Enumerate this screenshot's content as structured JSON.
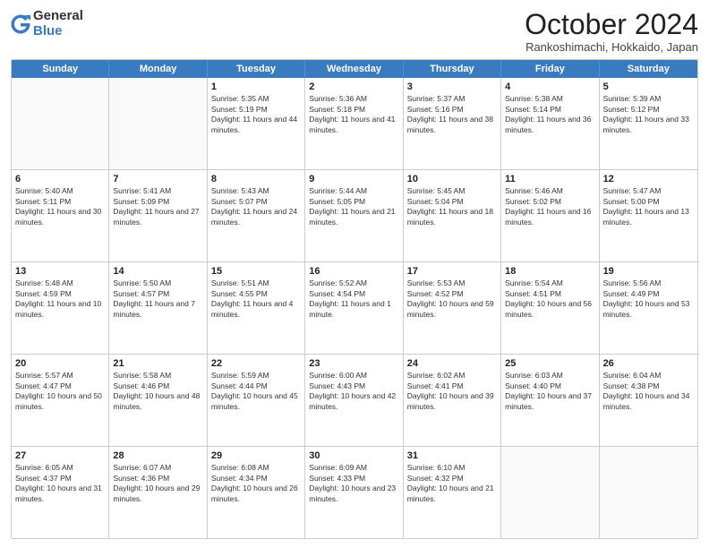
{
  "logo": {
    "general": "General",
    "blue": "Blue"
  },
  "title": "October 2024",
  "subtitle": "Rankoshimachi, Hokkaido, Japan",
  "headers": [
    "Sunday",
    "Monday",
    "Tuesday",
    "Wednesday",
    "Thursday",
    "Friday",
    "Saturday"
  ],
  "weeks": [
    [
      {
        "day": "",
        "sunrise": "",
        "sunset": "",
        "daylight": ""
      },
      {
        "day": "",
        "sunrise": "",
        "sunset": "",
        "daylight": ""
      },
      {
        "day": "1",
        "sunrise": "Sunrise: 5:35 AM",
        "sunset": "Sunset: 5:19 PM",
        "daylight": "Daylight: 11 hours and 44 minutes."
      },
      {
        "day": "2",
        "sunrise": "Sunrise: 5:36 AM",
        "sunset": "Sunset: 5:18 PM",
        "daylight": "Daylight: 11 hours and 41 minutes."
      },
      {
        "day": "3",
        "sunrise": "Sunrise: 5:37 AM",
        "sunset": "Sunset: 5:16 PM",
        "daylight": "Daylight: 11 hours and 38 minutes."
      },
      {
        "day": "4",
        "sunrise": "Sunrise: 5:38 AM",
        "sunset": "Sunset: 5:14 PM",
        "daylight": "Daylight: 11 hours and 36 minutes."
      },
      {
        "day": "5",
        "sunrise": "Sunrise: 5:39 AM",
        "sunset": "Sunset: 5:12 PM",
        "daylight": "Daylight: 11 hours and 33 minutes."
      }
    ],
    [
      {
        "day": "6",
        "sunrise": "Sunrise: 5:40 AM",
        "sunset": "Sunset: 5:11 PM",
        "daylight": "Daylight: 11 hours and 30 minutes."
      },
      {
        "day": "7",
        "sunrise": "Sunrise: 5:41 AM",
        "sunset": "Sunset: 5:09 PM",
        "daylight": "Daylight: 11 hours and 27 minutes."
      },
      {
        "day": "8",
        "sunrise": "Sunrise: 5:43 AM",
        "sunset": "Sunset: 5:07 PM",
        "daylight": "Daylight: 11 hours and 24 minutes."
      },
      {
        "day": "9",
        "sunrise": "Sunrise: 5:44 AM",
        "sunset": "Sunset: 5:05 PM",
        "daylight": "Daylight: 11 hours and 21 minutes."
      },
      {
        "day": "10",
        "sunrise": "Sunrise: 5:45 AM",
        "sunset": "Sunset: 5:04 PM",
        "daylight": "Daylight: 11 hours and 18 minutes."
      },
      {
        "day": "11",
        "sunrise": "Sunrise: 5:46 AM",
        "sunset": "Sunset: 5:02 PM",
        "daylight": "Daylight: 11 hours and 16 minutes."
      },
      {
        "day": "12",
        "sunrise": "Sunrise: 5:47 AM",
        "sunset": "Sunset: 5:00 PM",
        "daylight": "Daylight: 11 hours and 13 minutes."
      }
    ],
    [
      {
        "day": "13",
        "sunrise": "Sunrise: 5:48 AM",
        "sunset": "Sunset: 4:59 PM",
        "daylight": "Daylight: 11 hours and 10 minutes."
      },
      {
        "day": "14",
        "sunrise": "Sunrise: 5:50 AM",
        "sunset": "Sunset: 4:57 PM",
        "daylight": "Daylight: 11 hours and 7 minutes."
      },
      {
        "day": "15",
        "sunrise": "Sunrise: 5:51 AM",
        "sunset": "Sunset: 4:55 PM",
        "daylight": "Daylight: 11 hours and 4 minutes."
      },
      {
        "day": "16",
        "sunrise": "Sunrise: 5:52 AM",
        "sunset": "Sunset: 4:54 PM",
        "daylight": "Daylight: 11 hours and 1 minute."
      },
      {
        "day": "17",
        "sunrise": "Sunrise: 5:53 AM",
        "sunset": "Sunset: 4:52 PM",
        "daylight": "Daylight: 10 hours and 59 minutes."
      },
      {
        "day": "18",
        "sunrise": "Sunrise: 5:54 AM",
        "sunset": "Sunset: 4:51 PM",
        "daylight": "Daylight: 10 hours and 56 minutes."
      },
      {
        "day": "19",
        "sunrise": "Sunrise: 5:56 AM",
        "sunset": "Sunset: 4:49 PM",
        "daylight": "Daylight: 10 hours and 53 minutes."
      }
    ],
    [
      {
        "day": "20",
        "sunrise": "Sunrise: 5:57 AM",
        "sunset": "Sunset: 4:47 PM",
        "daylight": "Daylight: 10 hours and 50 minutes."
      },
      {
        "day": "21",
        "sunrise": "Sunrise: 5:58 AM",
        "sunset": "Sunset: 4:46 PM",
        "daylight": "Daylight: 10 hours and 48 minutes."
      },
      {
        "day": "22",
        "sunrise": "Sunrise: 5:59 AM",
        "sunset": "Sunset: 4:44 PM",
        "daylight": "Daylight: 10 hours and 45 minutes."
      },
      {
        "day": "23",
        "sunrise": "Sunrise: 6:00 AM",
        "sunset": "Sunset: 4:43 PM",
        "daylight": "Daylight: 10 hours and 42 minutes."
      },
      {
        "day": "24",
        "sunrise": "Sunrise: 6:02 AM",
        "sunset": "Sunset: 4:41 PM",
        "daylight": "Daylight: 10 hours and 39 minutes."
      },
      {
        "day": "25",
        "sunrise": "Sunrise: 6:03 AM",
        "sunset": "Sunset: 4:40 PM",
        "daylight": "Daylight: 10 hours and 37 minutes."
      },
      {
        "day": "26",
        "sunrise": "Sunrise: 6:04 AM",
        "sunset": "Sunset: 4:38 PM",
        "daylight": "Daylight: 10 hours and 34 minutes."
      }
    ],
    [
      {
        "day": "27",
        "sunrise": "Sunrise: 6:05 AM",
        "sunset": "Sunset: 4:37 PM",
        "daylight": "Daylight: 10 hours and 31 minutes."
      },
      {
        "day": "28",
        "sunrise": "Sunrise: 6:07 AM",
        "sunset": "Sunset: 4:36 PM",
        "daylight": "Daylight: 10 hours and 29 minutes."
      },
      {
        "day": "29",
        "sunrise": "Sunrise: 6:08 AM",
        "sunset": "Sunset: 4:34 PM",
        "daylight": "Daylight: 10 hours and 26 minutes."
      },
      {
        "day": "30",
        "sunrise": "Sunrise: 6:09 AM",
        "sunset": "Sunset: 4:33 PM",
        "daylight": "Daylight: 10 hours and 23 minutes."
      },
      {
        "day": "31",
        "sunrise": "Sunrise: 6:10 AM",
        "sunset": "Sunset: 4:32 PM",
        "daylight": "Daylight: 10 hours and 21 minutes."
      },
      {
        "day": "",
        "sunrise": "",
        "sunset": "",
        "daylight": ""
      },
      {
        "day": "",
        "sunrise": "",
        "sunset": "",
        "daylight": ""
      }
    ]
  ]
}
